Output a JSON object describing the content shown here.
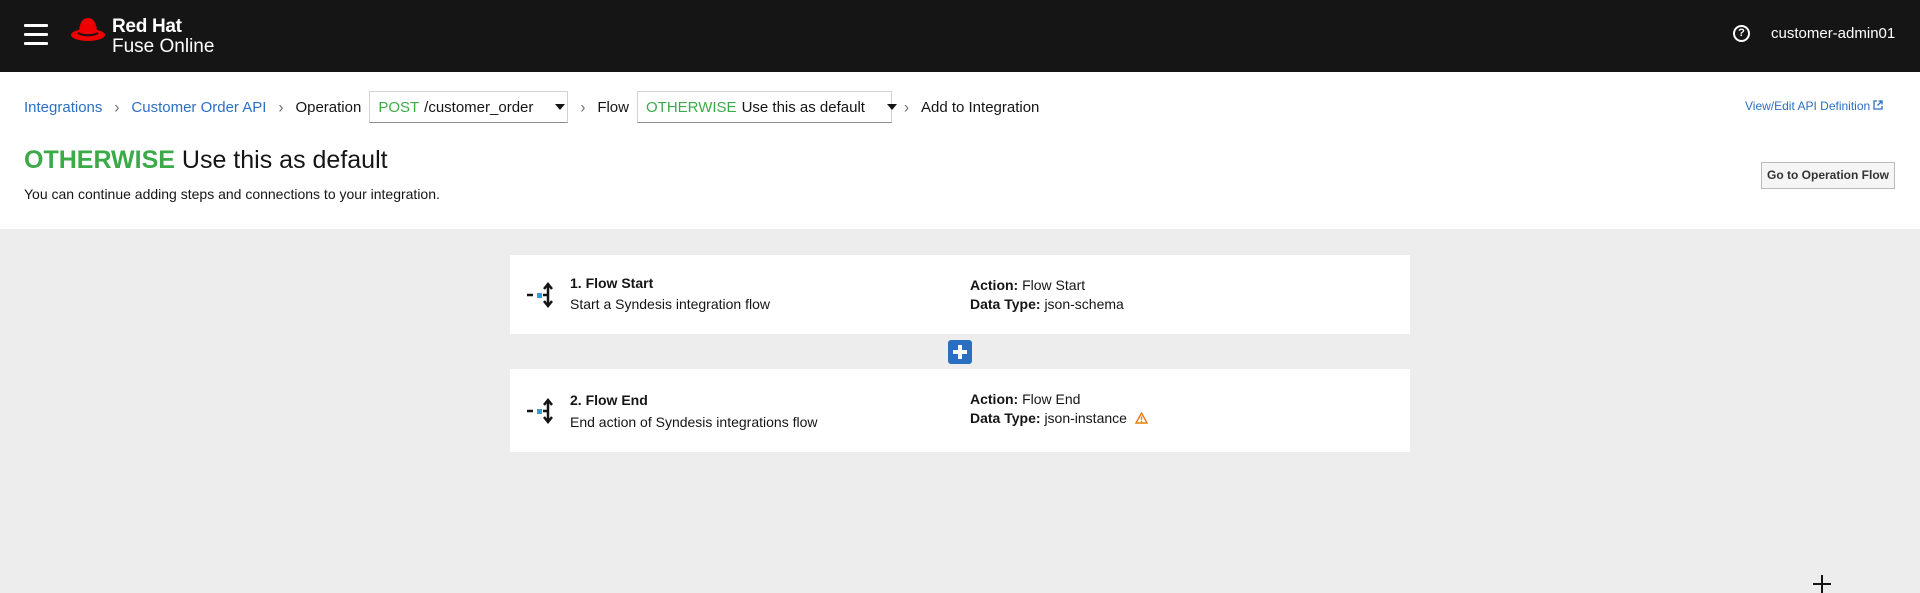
{
  "masthead": {
    "brand_line1": "Red Hat",
    "brand_line2": "Fuse Online",
    "user": "customer-admin01",
    "help_icon": "question-circle-icon"
  },
  "breadcrumb": {
    "integrations": "Integrations",
    "integration_name": "Customer Order API",
    "operation_label": "Operation",
    "operation_method": "POST",
    "operation_path": "/customer_order",
    "flow_label": "Flow",
    "flow_keyword": "OTHERWISE",
    "flow_name": "Use this as default",
    "last": "Add to Integration",
    "separator": "›"
  },
  "api_link": "View/Edit API Definition",
  "title": {
    "keyword": "OTHERWISE",
    "text": "Use this as default",
    "subtitle": "You can continue adding steps and connections to your integration."
  },
  "go_button": "Go to Operation Flow",
  "steps": [
    {
      "name": "1. Flow Start",
      "description": "Start a Syndesis integration flow",
      "action_label": "Action:",
      "action": "Flow Start",
      "datatype_label": "Data Type:",
      "datatype": "json-schema"
    },
    {
      "name": "2. Flow End",
      "description": "End action of Syndesis integrations flow",
      "action_label": "Action:",
      "action": "Flow End",
      "datatype_label": "Data Type:",
      "datatype": "json-instance"
    }
  ],
  "colors": {
    "masthead": "#151515",
    "link": "#2b6fc3",
    "accent_green": "#3daa4a",
    "warning": "#ec7a08",
    "canvas": "#ededed"
  }
}
